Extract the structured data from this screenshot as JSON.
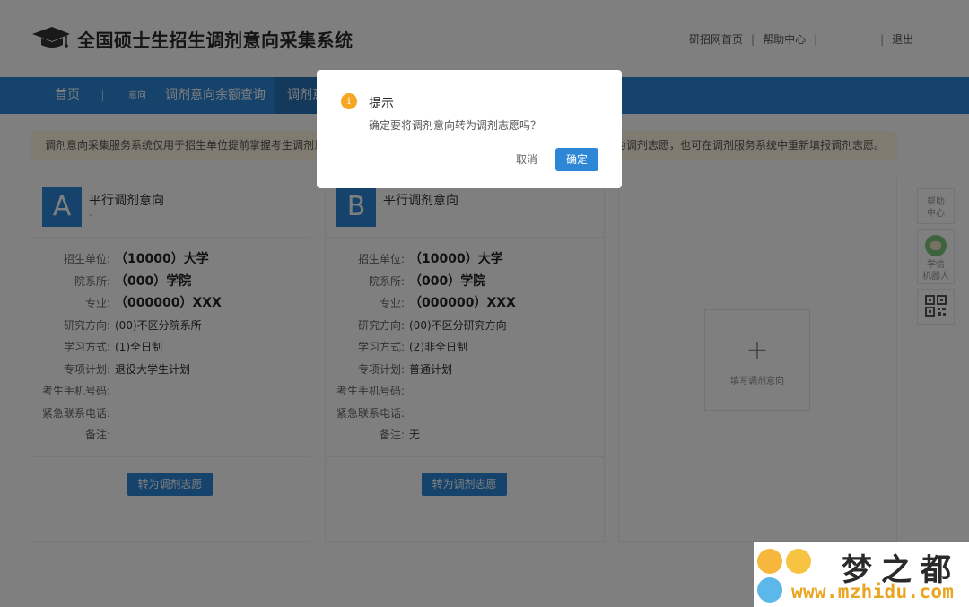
{
  "header": {
    "title": "全国硕士生招生调剂意向采集系统",
    "links": [
      "研招网首页",
      "帮助中心",
      "退出"
    ],
    "separator": "|"
  },
  "nav": {
    "home": "首页",
    "small_label": "意向",
    "quota_query": "调剂意向余额查询",
    "active_partial": "调剂意"
  },
  "notice": {
    "left_text": "调剂意向采集服务系统仅用于招生单位提前掌握考生调剂意愿",
    "right_text": "转为调剂志愿，也可在调剂服务系统中重新填报调剂志愿。"
  },
  "cards": [
    {
      "badge": "A",
      "title": "平行调剂意向",
      "subtitle": "-",
      "labels": [
        "招生单位:",
        "院系所:",
        "专业:",
        "研究方向:",
        "学习方式:",
        "专项计划:",
        "考生手机号码:",
        "紧急联系电话:",
        "备注:"
      ],
      "values": [
        "（10000）大学",
        "（000）学院",
        "（000000）XXX",
        "(00)不区分院系所",
        "(1)全日制",
        "退役大学生计划",
        "",
        "",
        ""
      ],
      "button": "转为调剂志愿"
    },
    {
      "badge": "B",
      "title": "平行调剂意向",
      "subtitle": "",
      "labels": [
        "招生单位:",
        "院系所:",
        "专业:",
        "研究方向:",
        "学习方式:",
        "专项计划:",
        "考生手机号码:",
        "紧急联系电话:",
        "备注:"
      ],
      "values": [
        "（10000）大学",
        "（000）学院",
        "（000000）XXX",
        "(00)不区分研究方向",
        "(2)非全日制",
        "普通计划",
        "",
        "",
        "无"
      ],
      "button": "转为调剂志愿"
    }
  ],
  "add_card": {
    "plus": "+",
    "label": "填写调剂意向"
  },
  "side": {
    "help": [
      "帮助",
      "中心"
    ],
    "bot": [
      "学信",
      "机器人"
    ]
  },
  "dialog": {
    "title": "提示",
    "icon": "i",
    "message": "确定要将调剂意向转为调剂志愿吗？",
    "cancel": "取消",
    "ok": "确定"
  },
  "watermark": {
    "text": "梦之都",
    "url": "www.mzhidu.com"
  },
  "colors": {
    "primary": "#2d86d6",
    "warning": "#f5a623",
    "notice_bg": "#fff7e0"
  }
}
